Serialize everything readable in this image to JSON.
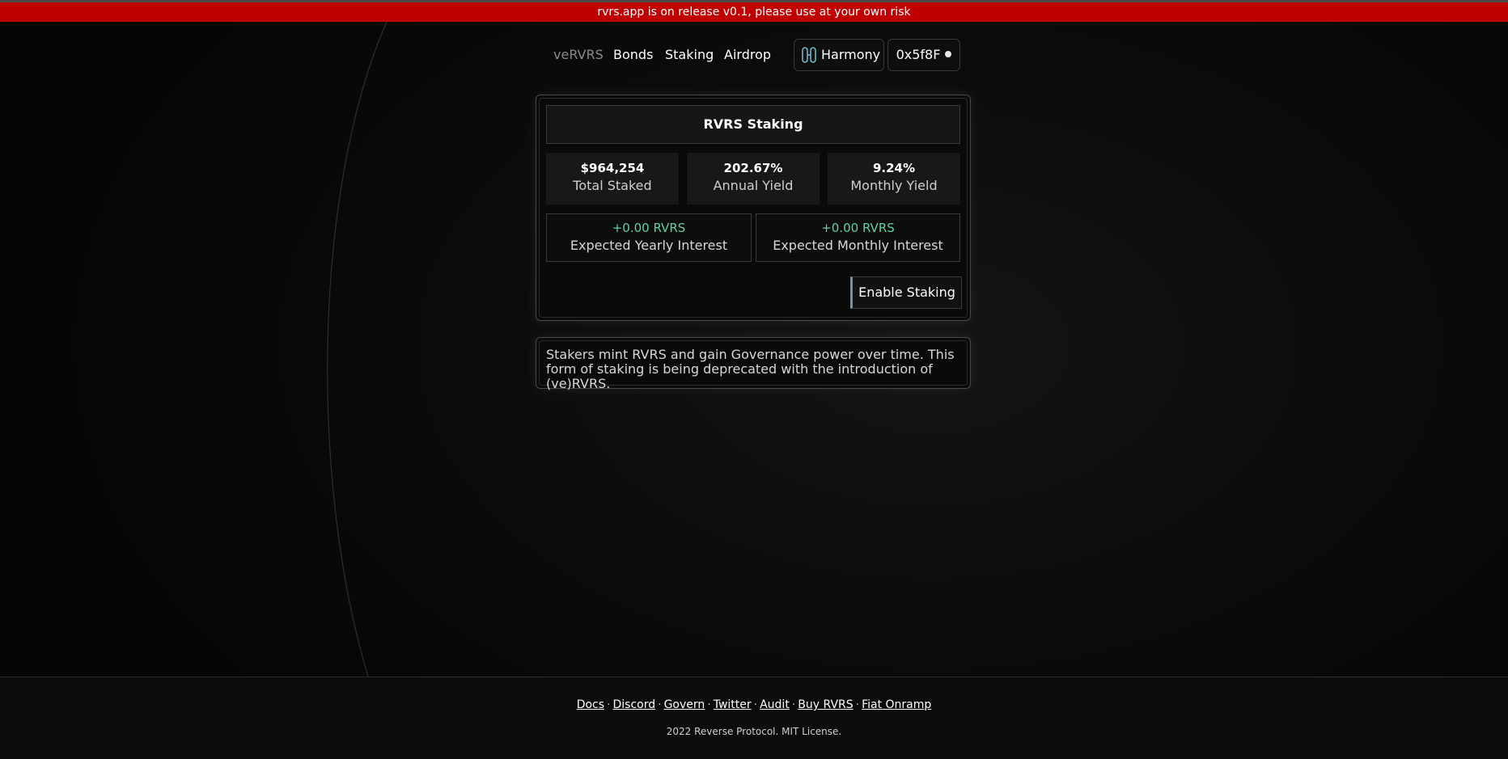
{
  "banner": {
    "text": "rvrs.app is on release v0.1, please use at your own risk"
  },
  "nav": {
    "links": [
      {
        "label": "veRVRS"
      },
      {
        "label": "Bonds"
      },
      {
        "label": "Staking"
      },
      {
        "label": "Airdrop"
      }
    ],
    "network": {
      "label": "Harmony",
      "icon": "harmony-icon"
    },
    "wallet": {
      "label": "0x5f8F",
      "status_icon": "dot-icon"
    }
  },
  "staking": {
    "title": "RVRS Staking",
    "stats": [
      {
        "value": "$964,254",
        "label": "Total Staked"
      },
      {
        "value": "202.67%",
        "label": "Annual Yield"
      },
      {
        "value": "9.24%",
        "label": "Monthly Yield"
      }
    ],
    "interest": [
      {
        "value": "+0.00 RVRS",
        "label": "Expected Yearly Interest"
      },
      {
        "value": "+0.00 RVRS",
        "label": "Expected Monthly Interest"
      }
    ],
    "enable_button": "Enable Staking"
  },
  "info": {
    "text": "Stakers mint RVRS and gain Governance power over time. This form of staking is being deprecated with the introduction of (ve)RVRS."
  },
  "footer": {
    "links": [
      "Docs",
      "Discord",
      "Govern",
      "Twitter",
      "Audit",
      "Buy RVRS",
      "Fiat Onramp"
    ],
    "separator": "·",
    "copyright": "2022 Reverse Protocol. MIT License."
  },
  "colors": {
    "banner": "#c00000",
    "interest_value": "#5fd3a0",
    "button_accent": "#6a9aa5"
  }
}
